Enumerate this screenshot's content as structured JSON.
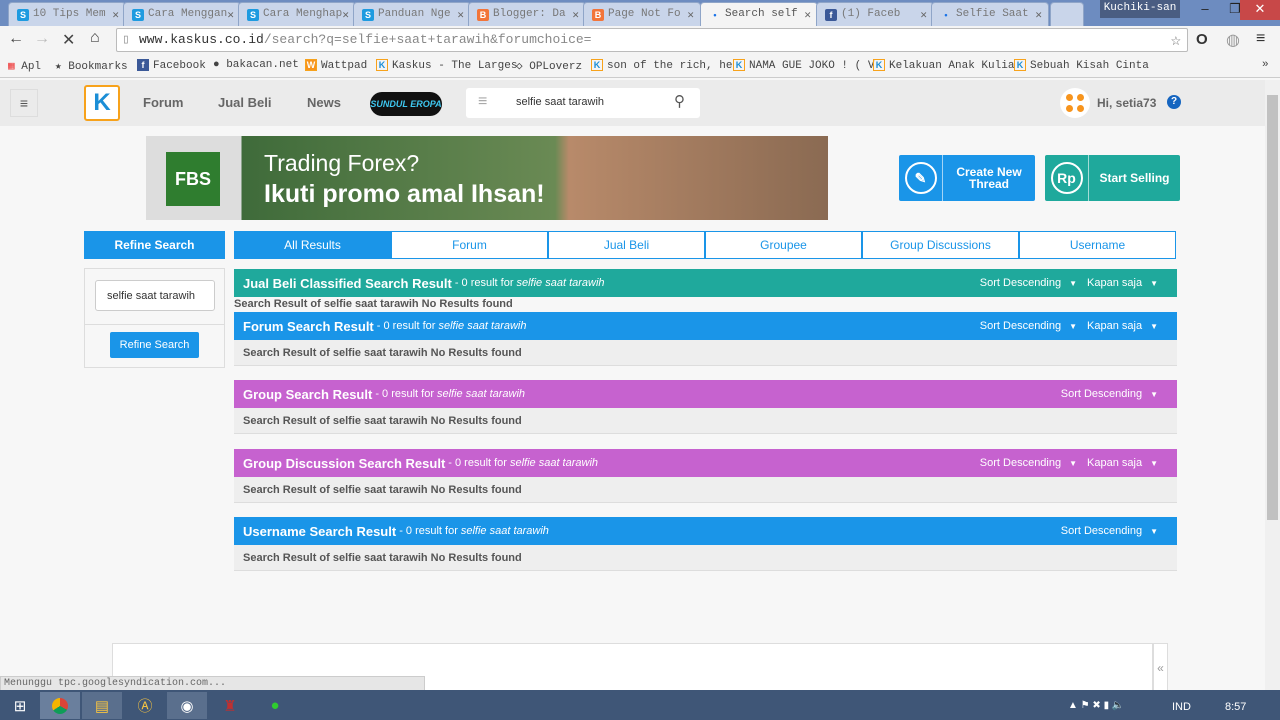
{
  "browser": {
    "tabs": [
      {
        "title": "10 Tips Mem",
        "icon": "s-icon",
        "color": "#1e9be0"
      },
      {
        "title": "Cara Menggan",
        "icon": "s-icon",
        "color": "#1e9be0"
      },
      {
        "title": "Cara Menghap",
        "icon": "s-icon",
        "color": "#1e9be0"
      },
      {
        "title": "Panduan Nge",
        "icon": "s-icon",
        "color": "#1e9be0"
      },
      {
        "title": "Blogger: Da",
        "icon": "blogger-icon",
        "color": "#f2753a"
      },
      {
        "title": "Page Not Fo",
        "icon": "blogger-icon",
        "color": "#f2753a"
      },
      {
        "title": "Search self",
        "icon": "loading-icon",
        "color": "#1a73e8"
      },
      {
        "title": "(1) Faceb",
        "icon": "facebook-icon",
        "color": "#3b5998"
      },
      {
        "title": "Selfie Saat",
        "icon": "loading-icon",
        "color": "#1a73e8"
      }
    ],
    "profile": "Kuchiki-san",
    "url_host": "www.kaskus.co.id",
    "url_path": "/search?q=selfie+saat+tarawih&forumchoice=",
    "bookmarks": [
      "Apl",
      "Bookmarks",
      "Facebook",
      "bakacan.net",
      "Wattpad",
      "Kaskus - The Larges",
      "OPLoverz",
      "son of the rich, he",
      "NAMA GUE JOKO ! ( V",
      "Kelakuan Anak Kulia",
      "Sebuah Kisah Cinta"
    ],
    "bookmarks_more": "»",
    "status": "Menunggu tpc.googlesyndication.com..."
  },
  "header": {
    "nav": [
      "Forum",
      "Jual Beli",
      "News"
    ],
    "promo_logo": "SUNDUL EROPA",
    "search_value": "selfie saat tarawih",
    "greeting": "Hi, setia73",
    "help": "?"
  },
  "banner": {
    "brand": "FBS",
    "line1": "Trading Forex?",
    "line2": "Ikuti promo amal Ihsan!"
  },
  "actions": {
    "create": "Create New Thread",
    "create_icon": "pencil-icon",
    "sell": "Start Selling",
    "sell_icon": "Rp"
  },
  "sidebar": {
    "title": "Refine Search",
    "input_value": "selfie saat tarawih",
    "button": "Refine Search"
  },
  "result_tabs": [
    "All Results",
    "Forum",
    "Jual Beli",
    "Groupee",
    "Group Discussions",
    "Username"
  ],
  "sections": [
    {
      "title": "Jual Beli Classified Search Result",
      "count": "- 0 result for",
      "query": "selfie saat tarawih",
      "sort": "Sort Descending",
      "time": "Kapan saja",
      "color": "#1fa99c",
      "body": "Search Result of selfie saat tarawih No Results found"
    },
    {
      "title": "Forum Search Result",
      "count": "- 0 result for",
      "query": "selfie saat tarawih",
      "sort": "Sort Descending",
      "time": "Kapan saja",
      "color": "#1a95e8",
      "body": "Search Result of selfie saat tarawih No Results found"
    },
    {
      "title": "Group Search Result",
      "count": "- 0 result for",
      "query": "selfie saat tarawih",
      "sort": "Sort Descending",
      "color": "#c662cf",
      "body": "Search Result of selfie saat tarawih No Results found"
    },
    {
      "title": "Group Discussion Search Result",
      "count": "- 0 result for",
      "query": "selfie saat tarawih",
      "sort": "Sort Descending",
      "time": "Kapan saja",
      "color": "#c662cf",
      "body": "Search Result of selfie saat tarawih No Results found"
    },
    {
      "title": "Username Search Result",
      "count": "- 0 result for",
      "query": "selfie saat tarawih",
      "sort": "Sort Descending",
      "color": "#1a95e8",
      "body": "Search Result of selfie saat tarawih No Results found"
    }
  ],
  "taskbar": {
    "lang": "IND",
    "time": "8:57"
  }
}
